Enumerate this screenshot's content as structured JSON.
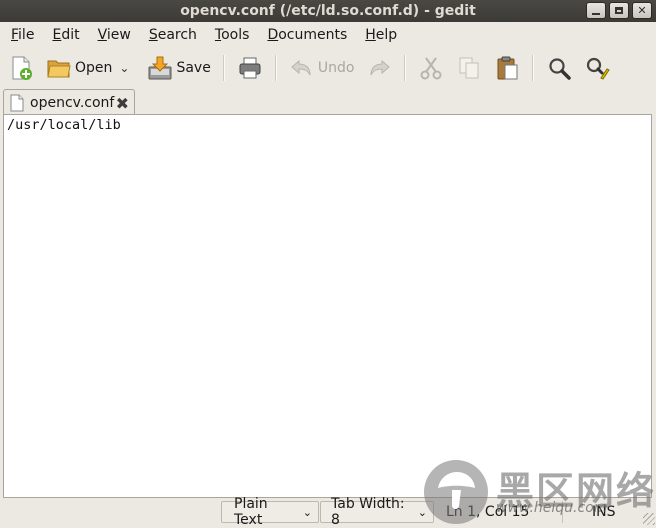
{
  "window": {
    "title": "opencv.conf (/etc/ld.so.conf.d) - gedit",
    "controls": {
      "minimize": "",
      "maximize": "",
      "close": "✕"
    }
  },
  "menubar": {
    "items": [
      {
        "first": "F",
        "rest": "ile"
      },
      {
        "first": "E",
        "rest": "dit"
      },
      {
        "first": "V",
        "rest": "iew"
      },
      {
        "first": "S",
        "rest": "earch"
      },
      {
        "first": "T",
        "rest": "ools"
      },
      {
        "first": "D",
        "rest": "ocuments"
      },
      {
        "first": "H",
        "rest": "elp"
      }
    ]
  },
  "toolbar": {
    "new_icon": "new-document-icon",
    "open_label": "Open",
    "open_dropdown": "⌄",
    "save_label": "Save",
    "print_icon": "printer-icon",
    "undo_label": "Undo",
    "redo_icon": "redo-icon",
    "cut_icon": "scissors-icon",
    "copy_icon": "copy-icon",
    "paste_icon": "clipboard-icon",
    "find_icon": "magnifier-icon",
    "replace_icon": "find-replace-icon"
  },
  "tabs": [
    {
      "label": "opencv.conf",
      "close": "✖",
      "active": true
    }
  ],
  "editor": {
    "content": "/usr/local/lib"
  },
  "statusbar": {
    "language": "Plain Text",
    "tab_width": "Tab Width:  8",
    "position": "Ln 1, Col 15",
    "mode": "INS",
    "dropdown": "⌄"
  },
  "watermark": {
    "text_cn": "黑区网络",
    "url": "www.heiqu.com"
  },
  "colors": {
    "titlebar": "#3b3a36",
    "window_bg": "#ece9e2",
    "editor_bg": "#ffffff"
  }
}
